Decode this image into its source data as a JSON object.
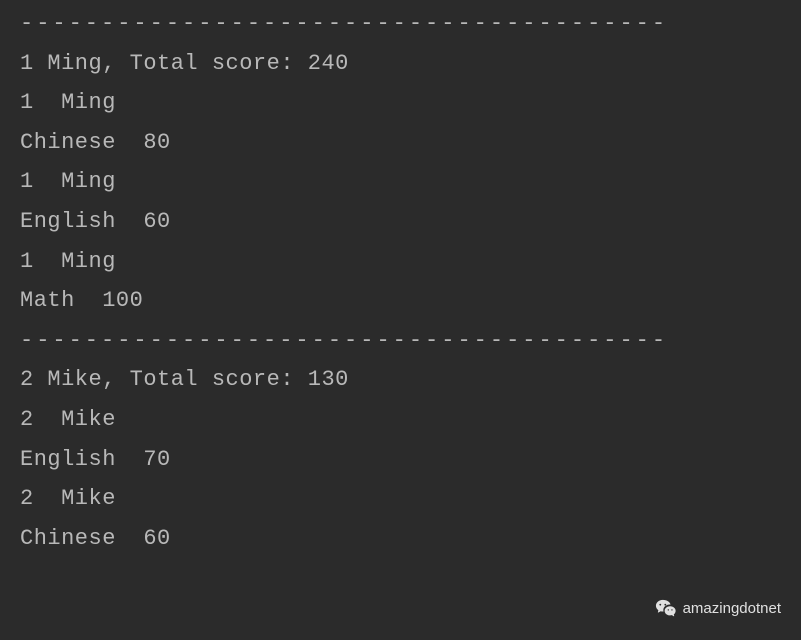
{
  "separator": "----------------------------------------",
  "students": [
    {
      "id": "1",
      "name": "Ming",
      "total": "240",
      "header": "1 Ming, Total score: 240",
      "scores": [
        {
          "id_name": "1  Ming",
          "subject_score": "Chinese  80"
        },
        {
          "id_name": "1  Ming",
          "subject_score": "English  60"
        },
        {
          "id_name": "1  Ming",
          "subject_score": "Math  100"
        }
      ]
    },
    {
      "id": "2",
      "name": "Mike",
      "total": "130",
      "header": "2 Mike, Total score: 130",
      "scores": [
        {
          "id_name": "2  Mike",
          "subject_score": "English  70"
        },
        {
          "id_name": "2  Mike",
          "subject_score": "Chinese  60"
        }
      ]
    }
  ],
  "watermark": {
    "text": "amazingdotnet"
  }
}
